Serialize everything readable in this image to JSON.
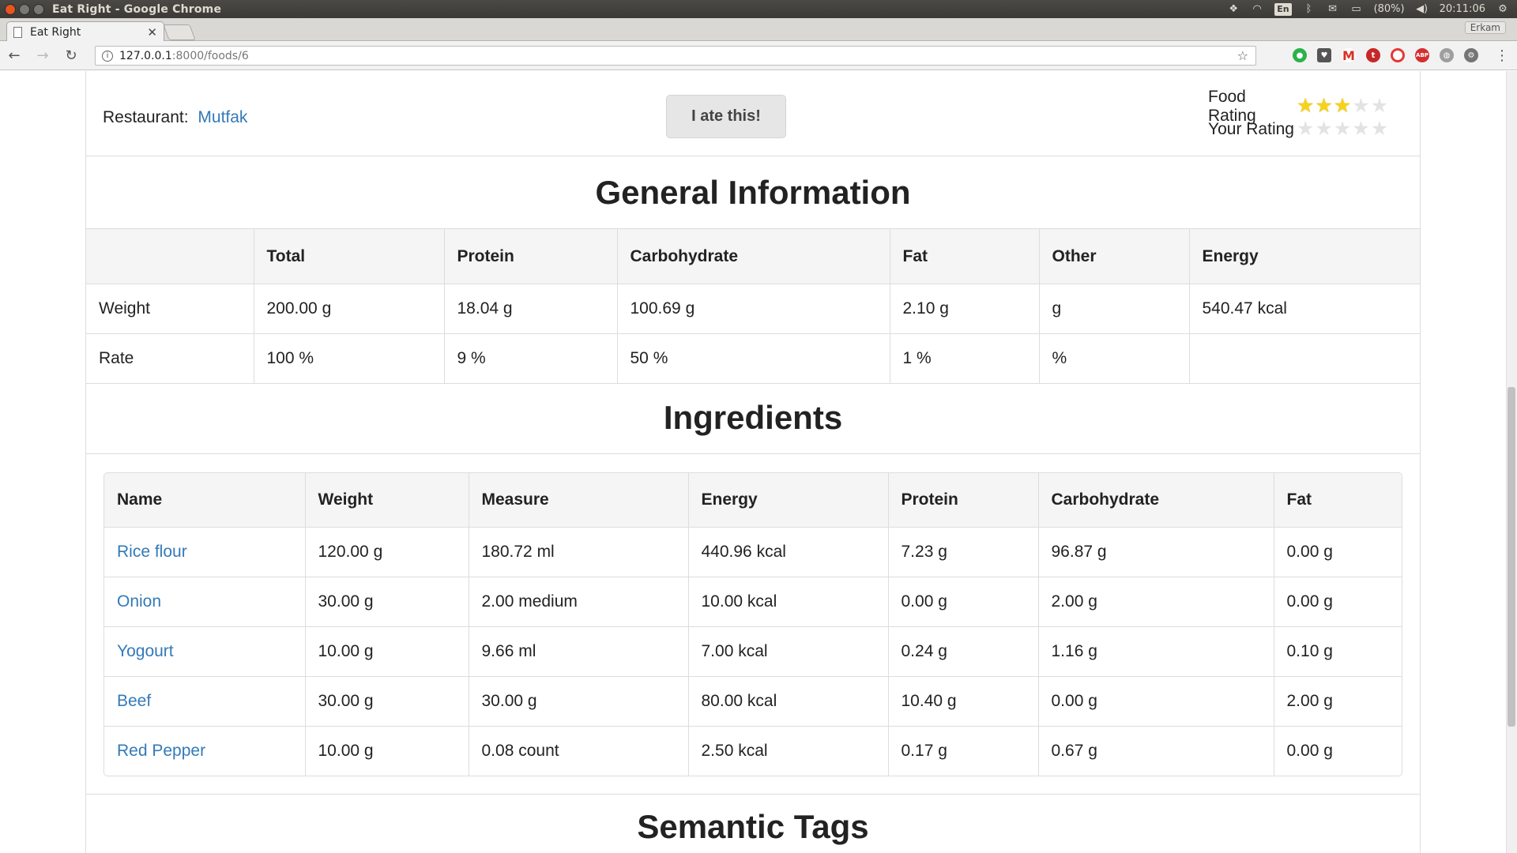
{
  "os": {
    "window_title": "Eat Right - Google Chrome",
    "lang": "En",
    "battery": "(80%)",
    "clock": "20:11:06"
  },
  "browser": {
    "tab_title": "Eat Right",
    "profile_name": "Erkam",
    "url_host": "127.0.0.1",
    "url_path": ":8000/foods/6"
  },
  "food": {
    "restaurant_label": "Restaurant:",
    "restaurant_name": "Mutfak",
    "ate_button": "I ate this!",
    "food_rating_label": "Food Rating",
    "your_rating_label": "Your Rating",
    "food_rating": 3,
    "your_rating": 0,
    "max_rating": 5
  },
  "general": {
    "title": "General Information",
    "headers": [
      "",
      "Total",
      "Protein",
      "Carbohydrate",
      "Fat",
      "Other",
      "Energy"
    ],
    "rows": [
      [
        "Weight",
        "200.00 g",
        "18.04 g",
        "100.69 g",
        "2.10 g",
        "g",
        "540.47 kcal"
      ],
      [
        "Rate",
        "100 %",
        "9 %",
        "50 %",
        "1 %",
        "%",
        ""
      ]
    ]
  },
  "ingredients": {
    "title": "Ingredients",
    "headers": [
      "Name",
      "Weight",
      "Measure",
      "Energy",
      "Protein",
      "Carbohydrate",
      "Fat"
    ],
    "rows": [
      [
        "Rice flour",
        "120.00 g",
        "180.72 ml",
        "440.96 kcal",
        "7.23 g",
        "96.87 g",
        "0.00 g"
      ],
      [
        "Onion",
        "30.00 g",
        "2.00 medium",
        "10.00 kcal",
        "0.00 g",
        "2.00 g",
        "0.00 g"
      ],
      [
        "Yogourt",
        "10.00 g",
        "9.66 ml",
        "7.00 kcal",
        "0.24 g",
        "1.16 g",
        "0.10 g"
      ],
      [
        "Beef",
        "30.00 g",
        "30.00 g",
        "80.00 kcal",
        "10.40 g",
        "0.00 g",
        "2.00 g"
      ],
      [
        "Red Pepper",
        "10.00 g",
        "0.08 count",
        "2.50 kcal",
        "0.17 g",
        "0.67 g",
        "0.00 g"
      ]
    ]
  },
  "semantic": {
    "title": "Semantic Tags"
  },
  "colors": {
    "link": "#337ab7",
    "star_on": "#f7d21a",
    "star_off": "#e3e3e3"
  }
}
